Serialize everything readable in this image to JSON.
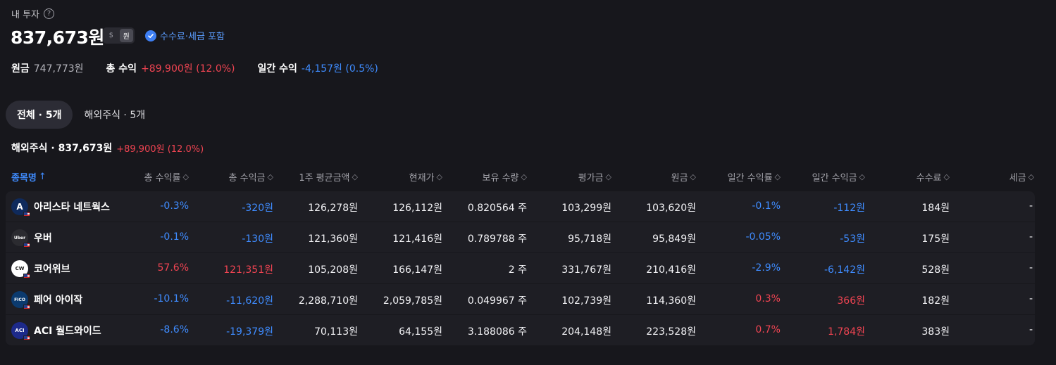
{
  "header": {
    "title": "내 투자",
    "help_icon": "?",
    "total_value": "837,673원",
    "currency_usd": "$",
    "currency_krw": "원",
    "fee_tax_label": "수수료·세금 포함"
  },
  "summary": {
    "principal_label": "원금",
    "principal_value": "747,773원",
    "total_return_label": "총 수익",
    "total_return_value": "+89,900원 (12.0%)",
    "daily_return_label": "일간 수익",
    "daily_return_value": "-4,157원 (0.5%)"
  },
  "tabs": [
    {
      "label": "전체 · 5개"
    },
    {
      "label": "해외주식 · 5개"
    }
  ],
  "section": {
    "name": "해외주식 · 837,673원",
    "delta": "+89,900원 (12.0%)"
  },
  "columns": {
    "name": "종목명",
    "name_sort": "↑",
    "total_rate": "총 수익률",
    "total_amount": "총 수익금",
    "avg_price": "1주 평균금액",
    "current_price": "현재가",
    "quantity": "보유 수량",
    "valuation": "평가금",
    "principal": "원금",
    "daily_rate": "일간 수익률",
    "daily_amount": "일간 수익금",
    "fee": "수수료",
    "tax": "세금"
  },
  "rows": [
    {
      "name": "아리스타 네트웍스",
      "logo_text": "A",
      "logo_bg": "#0f2a5c",
      "total_rate": "-0.3%",
      "total_amount": "-320원",
      "avg_price": "126,278원",
      "current_price": "126,112원",
      "quantity": "0.820564 주",
      "valuation": "103,299원",
      "principal": "103,620원",
      "daily_rate": "-0.1%",
      "daily_amount": "-112원",
      "fee": "184원",
      "tax": "-",
      "total_color": "blue",
      "daily_color": "blue"
    },
    {
      "name": "우버",
      "logo_text": "Uber",
      "logo_bg": "#2b2b30",
      "total_rate": "-0.1%",
      "total_amount": "-130원",
      "avg_price": "121,360원",
      "current_price": "121,416원",
      "quantity": "0.789788 주",
      "valuation": "95,718원",
      "principal": "95,849원",
      "daily_rate": "-0.05%",
      "daily_amount": "-53원",
      "fee": "175원",
      "tax": "-",
      "total_color": "blue",
      "daily_color": "blue"
    },
    {
      "name": "코어위브",
      "logo_text": "CW",
      "logo_bg": "#ffffff",
      "total_rate": "57.6%",
      "total_amount": "121,351원",
      "avg_price": "105,208원",
      "current_price": "166,147원",
      "quantity": "2 주",
      "valuation": "331,767원",
      "principal": "210,416원",
      "daily_rate": "-2.9%",
      "daily_amount": "-6,142원",
      "fee": "528원",
      "tax": "-",
      "total_color": "red",
      "daily_color": "blue"
    },
    {
      "name": "페어 아이작",
      "logo_text": "FICO",
      "logo_bg": "#0b3a6e",
      "total_rate": "-10.1%",
      "total_amount": "-11,620원",
      "avg_price": "2,288,710원",
      "current_price": "2,059,785원",
      "quantity": "0.049967 주",
      "valuation": "102,739원",
      "principal": "114,360원",
      "daily_rate": "0.3%",
      "daily_amount": "366원",
      "fee": "182원",
      "tax": "-",
      "total_color": "blue",
      "daily_color": "red"
    },
    {
      "name": "ACI 월드와이드",
      "logo_text": "ACI",
      "logo_bg": "#1d2a8a",
      "total_rate": "-8.6%",
      "total_amount": "-19,379원",
      "avg_price": "70,113원",
      "current_price": "64,155원",
      "quantity": "3.188086 주",
      "valuation": "204,148원",
      "principal": "223,528원",
      "daily_rate": "0.7%",
      "daily_amount": "1,784원",
      "fee": "383원",
      "tax": "-",
      "total_color": "blue",
      "daily_color": "red"
    }
  ],
  "colors": {
    "background": "#17171c",
    "row_bg": "#1e1e24",
    "red": "#f04452",
    "blue": "#3f8cff",
    "accent": "#3e7ff3"
  }
}
